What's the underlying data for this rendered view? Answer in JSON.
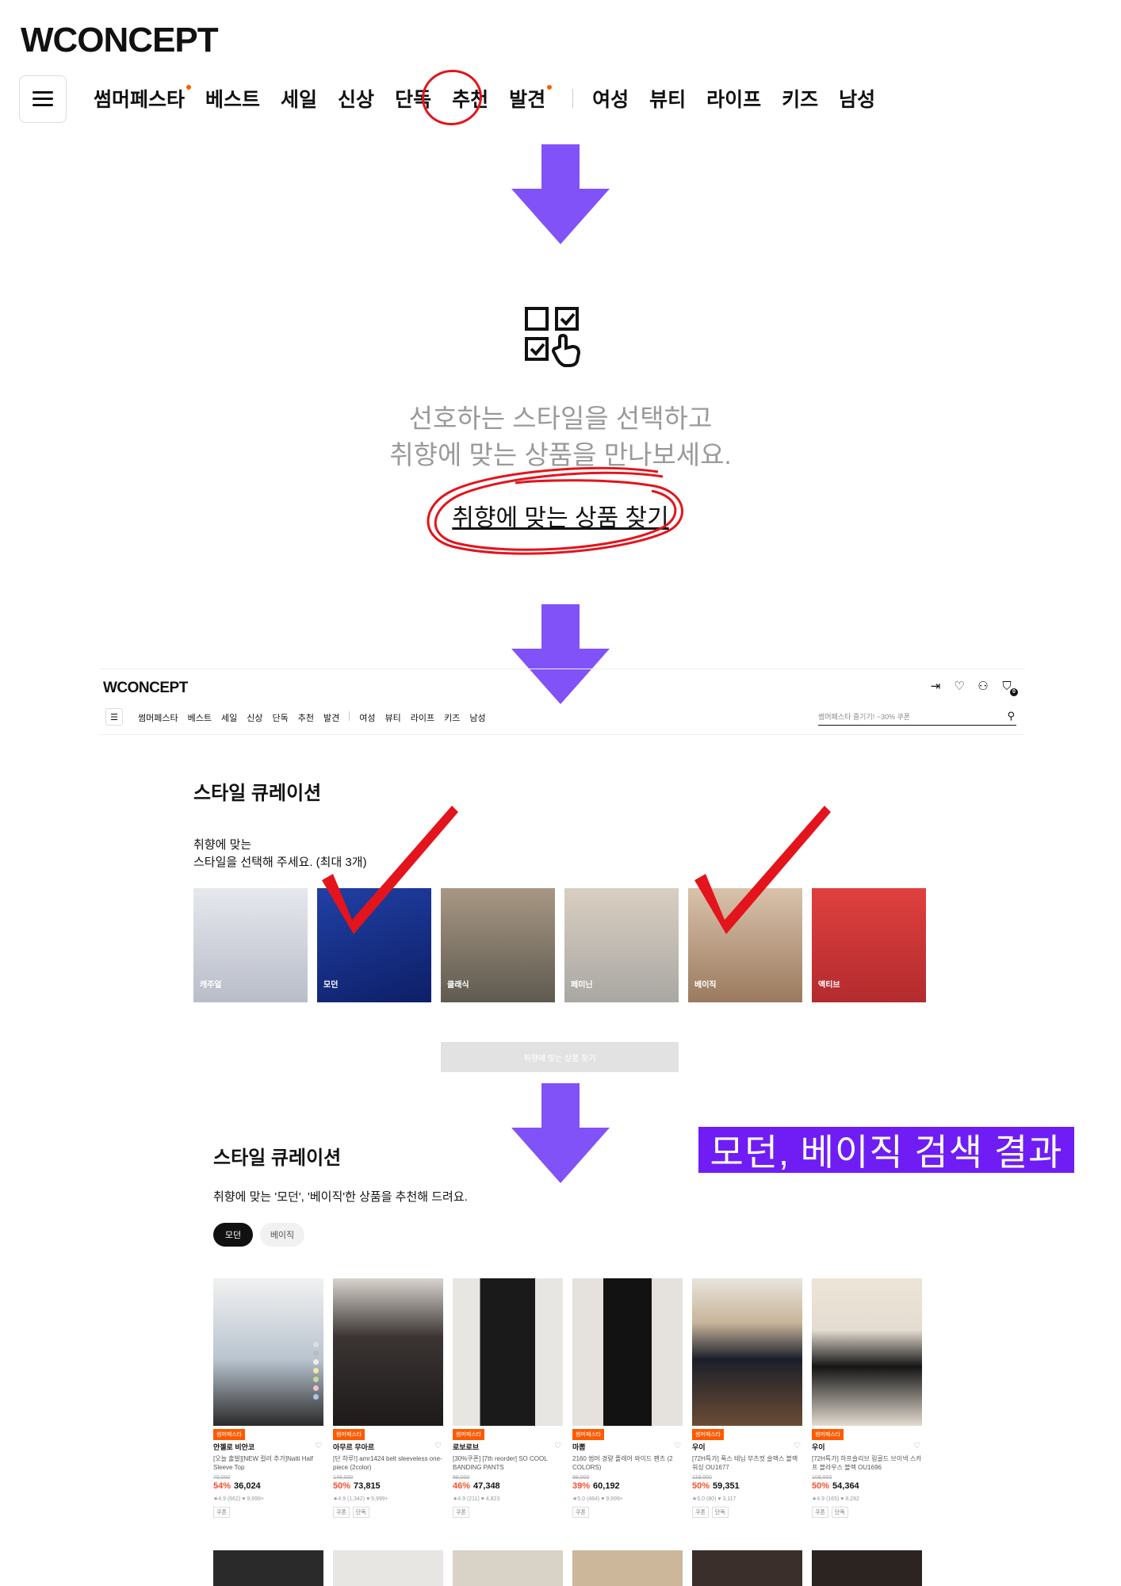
{
  "step1": {
    "logo": "WCONCEPT",
    "nav": [
      {
        "label": "썸머페스타",
        "dot": true
      },
      {
        "label": "베스트",
        "dot": false
      },
      {
        "label": "세일",
        "dot": false
      },
      {
        "label": "신상",
        "dot": false
      },
      {
        "label": "단독",
        "dot": false
      },
      {
        "label": "추천",
        "dot": false
      },
      {
        "label": "발견",
        "dot": true
      }
    ],
    "nav_right": [
      "여성",
      "뷰티",
      "라이프",
      "키즈",
      "남성"
    ]
  },
  "step2": {
    "line1": "선호하는 스타일을 선택하고",
    "line2": "취향에 맞는 상품을 만나보세요.",
    "link": "취향에 맞는 상품 찾기"
  },
  "step3": {
    "logo": "WCONCEPT",
    "nav": [
      "썸머페스타",
      "베스트",
      "세일",
      "신상",
      "단독",
      "추천",
      "발견"
    ],
    "nav_right": [
      "여성",
      "뷰티",
      "라이프",
      "키즈",
      "남성"
    ],
    "search_placeholder": "썸머페스타 즐기기! ~30% 쿠폰",
    "cart_count": "0",
    "title": "스타일 큐레이션",
    "sub1": "취향에 맞는",
    "sub2": "스타일을 선택해 주세요. (최대 3개)",
    "styles": [
      {
        "label": "캐주얼",
        "color": "#c9ccd6"
      },
      {
        "label": "모던",
        "color": "#1f3e9c"
      },
      {
        "label": "클래식",
        "color": "#8e7d6e"
      },
      {
        "label": "페미닌",
        "color": "#c4b8a6"
      },
      {
        "label": "베이직",
        "color": "#c9ad92"
      },
      {
        "label": "액티브",
        "color": "#d9383b"
      }
    ],
    "button": "취향에 맞는 상품 찾기"
  },
  "step4": {
    "banner": "모던, 베이직 검색 결과",
    "title": "스타일 큐레이션",
    "sub": "취향에 맞는 '모던', '베이직'한 상품을 추천해 드려요.",
    "chips": [
      "모던",
      "베이직"
    ],
    "products": [
      {
        "badge": "썸머페스타",
        "brand": "안젤로 비안코",
        "name": "[오늘 출발][NEW 컬러 추가]Natti Half Sleeve Top",
        "orig": "79,000",
        "discount": "54%",
        "price": "36,024",
        "meta": "★4.9 (662)  ♥ 9,999+",
        "tags": [
          "쿠폰"
        ],
        "color": "#b9c4cf"
      },
      {
        "badge": "썸머페스타",
        "brand": "아무르 무아르",
        "name": "[단 하루!] amr1424 belt sleeveless one-piece (2color)",
        "orig": "148,000",
        "discount": "50%",
        "price": "73,815",
        "meta": "★4.9 (1,342)  ♥ 9,999+",
        "tags": [
          "쿠폰",
          "단독"
        ],
        "color": "#3b3433"
      },
      {
        "badge": "썸머페스타",
        "brand": "로보로브",
        "name": "[30%쿠폰] [7th reorder] SO COOL BANDING PANTS",
        "orig": "89,000",
        "discount": "46%",
        "price": "47,348",
        "meta": "★4.9 (211)  ♥ 4,823",
        "tags": [
          "쿠폰"
        ],
        "color": "#d8d6d2"
      },
      {
        "badge": "썸머페스타",
        "brand": "마뽐",
        "name": "2160 썸머 경량 플레어 와이드 팬츠 (2 COLORS)",
        "orig": "99,000",
        "discount": "39%",
        "price": "60,192",
        "meta": "★5.0 (484)  ♥ 9,999+",
        "tags": [
          "쿠폰"
        ],
        "color": "#cfcac4"
      },
      {
        "badge": "썸머페스타",
        "brand": "우이",
        "name": "[72H특가] 폭스 테님 부츠컷 슬랙스 블랙워싱 OU1677",
        "orig": "119,000",
        "discount": "50%",
        "price": "59,351",
        "meta": "★5.0 (80)  ♥ 3,117",
        "tags": [
          "쿠폰",
          "단독"
        ],
        "color": "#8a7a62"
      },
      {
        "badge": "썸머페스타",
        "brand": "우이",
        "name": "[72H특가] 하프슬리브 링골드 브이넥 스카프 블라우스 블랙 OU1696",
        "orig": "109,000",
        "discount": "50%",
        "price": "54,364",
        "meta": "★4.9 (165)  ♥ 8,282",
        "tags": [
          "쿠폰",
          "단독"
        ],
        "color": "#e4dcd0"
      }
    ],
    "row2_colors": [
      "#2a2a2a",
      "#e8e6e2",
      "#d9d2c7",
      "#cdb79a",
      "#3a2f2a",
      "#2c2420"
    ]
  }
}
